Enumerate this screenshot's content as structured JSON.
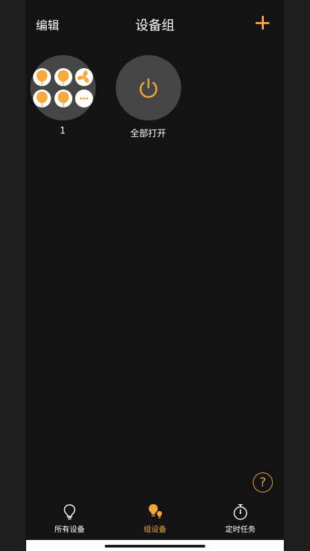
{
  "header": {
    "edit_label": "编辑",
    "title": "设备组"
  },
  "groups": [
    {
      "label": "1",
      "devices": [
        "bulb",
        "bulb",
        "fan",
        "bulb",
        "bulb",
        "more"
      ]
    },
    {
      "label": "全部打开",
      "icon": "power-icon"
    }
  ],
  "help": {
    "glyph": "?"
  },
  "tabs": [
    {
      "label": "所有设备",
      "icon": "lightbulb-icon",
      "active": false
    },
    {
      "label": "组设备",
      "icon": "group-bulbs-icon",
      "active": true
    },
    {
      "label": "定时任务",
      "icon": "stopwatch-icon",
      "active": false
    }
  ],
  "colors": {
    "accent": "#f4a43c",
    "background": "#131313",
    "circle": "#464646"
  }
}
